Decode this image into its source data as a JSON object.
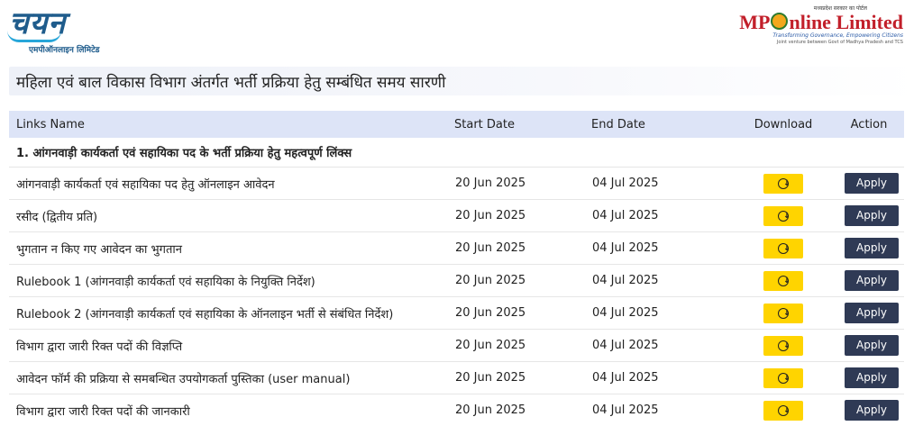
{
  "header": {
    "left_logo_mark": "चयन",
    "left_logo_sub": "एमपीऑनलाइन लिमिटेड",
    "right_logo_tag": "मध्यप्रदेश सरकार का पोर्टल",
    "right_logo_mp": "MP",
    "right_logo_rest": "nline Limited",
    "right_logo_slogan": "Transforming Governance, Empowering Citizens",
    "right_logo_slogan2": "Joint venture between Govt of Madhya Pradesh and TCS"
  },
  "page_title": "महिला एवं बाल विकास विभाग अंतर्गत भर्ती प्रक्रिया हेतु सम्बंधित समय सारणी",
  "table": {
    "headers": [
      "Links Name",
      "Start Date",
      "End Date",
      "Download",
      "Action"
    ],
    "section_title": "1. आंगनवाड़ी कार्यकर्ता एवं सहायिका पद के भर्ती प्रक्रिया हेतु महत्वपूर्ण लिंक्स",
    "rows": [
      {
        "name": "आंगनवाड़ी कार्यकर्ता एवं सहायिका पद हेतु ऑनलाइन आवेदन",
        "start": "20 Jun 2025",
        "end": "04 Jul 2025",
        "action": "Apply"
      },
      {
        "name": "रसीद (द्वितीय प्रति)",
        "start": "20 Jun 2025",
        "end": "04 Jul 2025",
        "action": "Apply"
      },
      {
        "name": "भुगतान न किए गए आवेदन का भुगतान",
        "start": "20 Jun 2025",
        "end": "04 Jul 2025",
        "action": "Apply"
      },
      {
        "name": "Rulebook 1 (आंगनवाड़ी कार्यकर्ता एवं सहायिका के नियुक्ति निर्देश)",
        "start": "20 Jun 2025",
        "end": "04 Jul 2025",
        "action": "Apply"
      },
      {
        "name": "Rulebook 2 (आंगनवाड़ी कार्यकर्ता एवं सहायिका के ऑनलाइन भर्ती से संबंधित निर्देश)",
        "start": "20 Jun 2025",
        "end": "04 Jul 2025",
        "action": "Apply"
      },
      {
        "name": "विभाग द्वारा जारी रिक्त पदों की विज्ञप्ति",
        "start": "20 Jun 2025",
        "end": "04 Jul 2025",
        "action": "Apply"
      },
      {
        "name": "आवेदन फॉर्म की प्रक्रिया से समबन्धित उपयोगकर्ता पुस्तिका (user manual)",
        "start": "20 Jun 2025",
        "end": "04 Jul 2025",
        "action": "Apply"
      },
      {
        "name": "विभाग द्वारा जारी रिक्त पदों की जानकारी",
        "start": "20 Jun 2025",
        "end": "04 Jul 2025",
        "action": "Apply"
      }
    ]
  },
  "colors": {
    "header_row_bg": "#dde4f7",
    "download_button": "#ffd400",
    "apply_button": "#2f3a55"
  },
  "icons": {
    "download": "download-circle-icon"
  }
}
